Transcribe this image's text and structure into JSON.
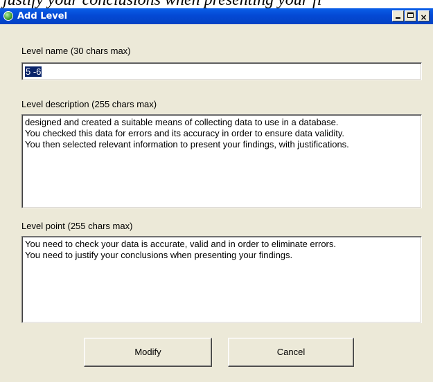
{
  "background_text": "justify your conclusions when presenting your fi",
  "window": {
    "title": "Add Level",
    "icon": "green-circle-app-icon",
    "controls": {
      "minimize": "minimize-icon",
      "maximize": "maximize-icon",
      "close": "×"
    }
  },
  "form": {
    "name_label": "Level name (30 chars max)",
    "name_value": "5 -6",
    "description_label": "Level description (255 chars max)",
    "description_value": "designed and created a suitable means of collecting data to use in a database.\nYou checked this data for errors and its accuracy in order to ensure data validity.\nYou then selected relevant information to present your findings, with justifications.",
    "point_label": "Level point (255 chars max)",
    "point_value": "You need to check your data is accurate, valid and in order to eliminate errors.\nYou need to justify your conclusions when presenting your findings."
  },
  "buttons": {
    "modify": "Modify",
    "cancel": "Cancel"
  },
  "colors": {
    "titlebar": "#0449d4",
    "dialog_face": "#ece9d8",
    "selection": "#0a246a"
  }
}
